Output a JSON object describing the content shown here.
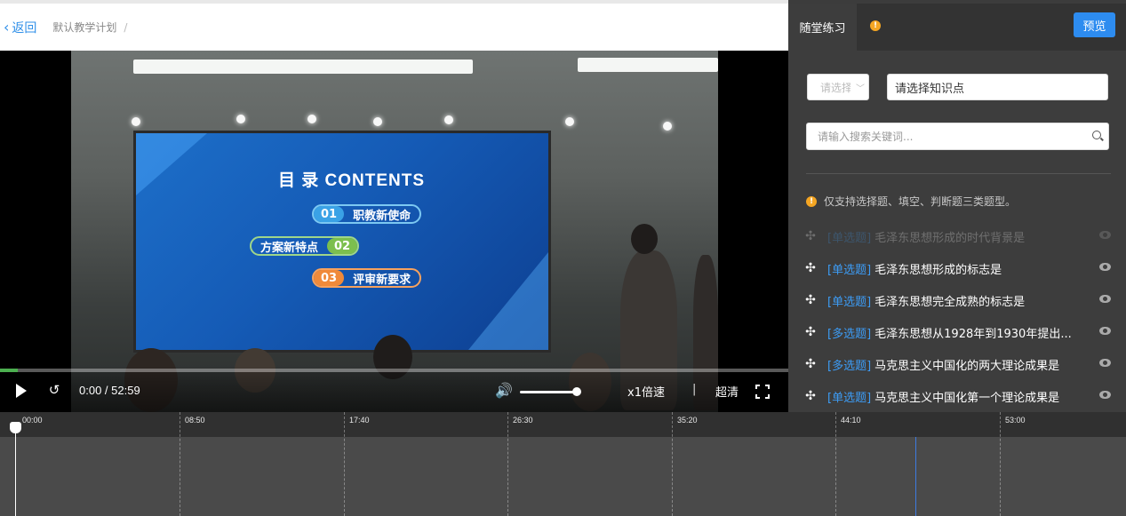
{
  "header": {
    "back_label": "返回",
    "back_chevron": "‹",
    "breadcrumb": "默认教学计划",
    "breadcrumb_separator": "/"
  },
  "video": {
    "slide": {
      "title": "目 录  CONTENTS",
      "items": [
        {
          "num": "01",
          "text": "职教新使命"
        },
        {
          "num": "02",
          "text": "方案新特点"
        },
        {
          "num": "03",
          "text": "评审新要求"
        }
      ]
    },
    "controls": {
      "time": "0:00 / 52:59",
      "speed": "x1倍速",
      "separator": "|",
      "quality": "超清",
      "volume_level": 0.95,
      "progress_fraction": 0.02
    }
  },
  "timeline": {
    "ticks": [
      "00:00",
      "08:50",
      "17:40",
      "26:30",
      "35:20",
      "44:10",
      "53:00"
    ]
  },
  "panel": {
    "tab_label": "随堂练习",
    "tab_info_icon": "!",
    "preview_label": "预览",
    "type_select_placeholder": "请选择",
    "knowledge_point_placeholder": "请选择知识点",
    "search_placeholder": "请输入搜索关键词...",
    "notice": "仅支持选择题、填空、判断题三类题型。",
    "questions": [
      {
        "type": "[单选题]",
        "title": "毛泽东思想形成的时代背景是",
        "dim": true
      },
      {
        "type": "[单选题]",
        "title": "毛泽东思想形成的标志是",
        "dim": false
      },
      {
        "type": "[单选题]",
        "title": "毛泽东思想完全成熟的标志是",
        "dim": false
      },
      {
        "type": "[多选题]",
        "title": "毛泽东思想从1928年到1930年提出...",
        "dim": false
      },
      {
        "type": "[多选题]",
        "title": "马克思主义中国化的两大理论成果是",
        "dim": false
      },
      {
        "type": "[单选题]",
        "title": "马克思主义中国化第一个理论成果是",
        "dim": false
      }
    ]
  },
  "colors": {
    "accent": "#2d8cf0",
    "question_type": "#3d9cf5",
    "info": "#f5a623",
    "progress": "#4caf50"
  }
}
